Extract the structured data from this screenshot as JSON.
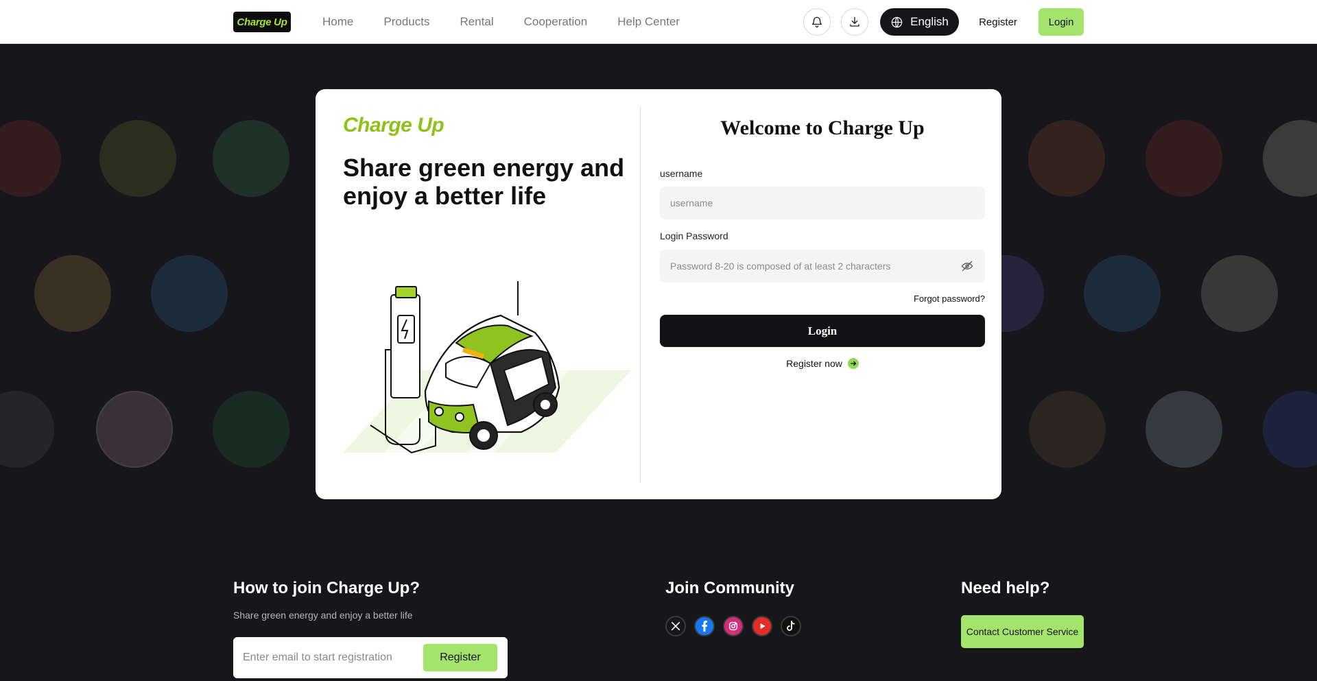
{
  "header": {
    "logo_text": "Charge Up",
    "nav": [
      "Home",
      "Products",
      "Rental",
      "Cooperation",
      "Help Center"
    ],
    "language": "English",
    "register_label": "Register",
    "login_label": "Login"
  },
  "card": {
    "brand": "Charge Up",
    "tagline": "Share green energy and enjoy a better life",
    "welcome": "Welcome to Charge Up",
    "username_label": "username",
    "username_placeholder": "username",
    "password_label": "Login Password",
    "password_placeholder": "Password 8-20 is composed of at least 2 characters",
    "forgot": "Forgot password?",
    "login_button": "Login",
    "register_now": "Register now"
  },
  "footer": {
    "join_title": "How to join Charge Up?",
    "join_sub": "Share green energy and enjoy a better life",
    "email_placeholder": "Enter email to start registration",
    "email_register": "Register",
    "community_title": "Join Community",
    "social": [
      "x-icon",
      "facebook-icon",
      "instagram-icon",
      "youtube-icon",
      "tiktok-icon"
    ],
    "help_title": "Need help?",
    "contact_button": "Contact Customer Service"
  },
  "colors": {
    "accent": "#a4e36c",
    "brand_green": "#8ec21a",
    "dark": "#16161a",
    "background": "#17171b"
  }
}
